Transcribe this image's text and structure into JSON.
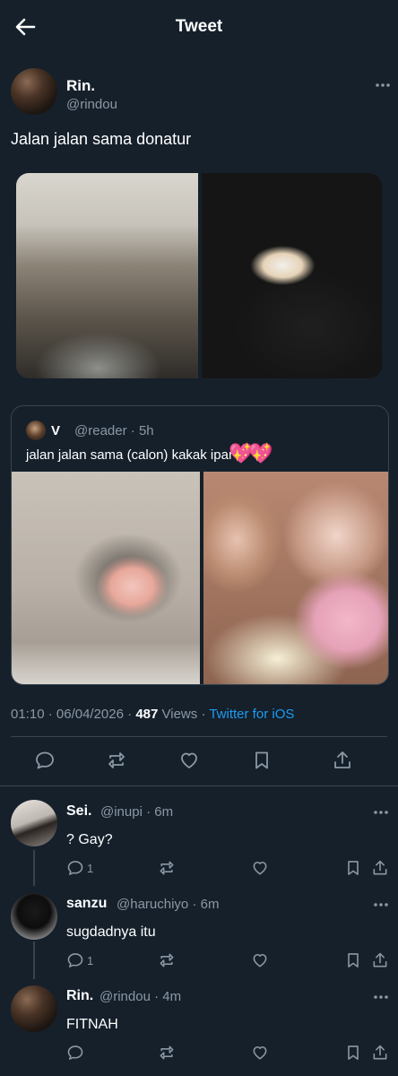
{
  "header": {
    "title": "Tweet"
  },
  "tweet": {
    "author_name": "Rin.",
    "author_handle": "@rindou",
    "text": "Jalan jalan sama donatur",
    "time": "01:10",
    "date": "06/04/2026",
    "views_count": "487",
    "views_label": "Views",
    "source": "Twitter for iOS"
  },
  "quote": {
    "author_name": "V",
    "author_handle": "@reader",
    "time": "5h",
    "text": "jalan jalan sama (calon) kakak ipar",
    "emoji": "💖"
  },
  "replies": [
    {
      "name": "Sei.",
      "handle": "@inupi",
      "time": "6m",
      "text": "? Gay?",
      "reply_count": "1"
    },
    {
      "name": "sanzu",
      "handle": "@haruchiyo",
      "time": "6m",
      "text": "sugdadnya itu",
      "reply_count": "1"
    },
    {
      "name": "Rin.",
      "handle": "@rindou",
      "time": "4m",
      "text": "FITNAH",
      "reply_count": ""
    }
  ],
  "icons": {
    "back": "arrow-left-icon",
    "more": "more-icon",
    "reply": "reply-icon",
    "retweet": "retweet-icon",
    "like": "heart-icon",
    "bookmark": "bookmark-icon",
    "share": "share-icon"
  },
  "colors": {
    "background": "#15202b",
    "accent": "#1d9bf0",
    "muted": "#8b98a5",
    "divider": "#38444d"
  }
}
